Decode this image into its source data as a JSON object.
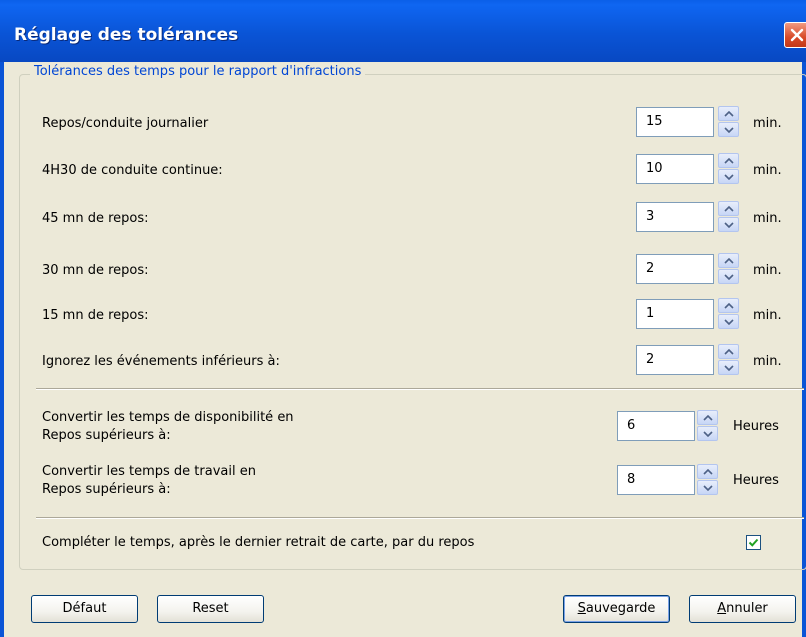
{
  "window": {
    "title": "Réglage des tolérances",
    "close_icon": "close-x-icon"
  },
  "group": {
    "legend": "Tolérances des temps pour le rapport d'infractions"
  },
  "rows": [
    {
      "label": "Repos/conduite journalier",
      "value": "15",
      "unit": "min."
    },
    {
      "label": "4H30 de conduite continue:",
      "value": "10",
      "unit": "min."
    },
    {
      "label": "45 mn de repos:",
      "value": "3",
      "unit": "min."
    },
    {
      "label": "30 mn de repos:",
      "value": "2",
      "unit": "min."
    },
    {
      "label": "15 mn de repos:",
      "value": "1",
      "unit": "min."
    },
    {
      "label": "Ignorez les événements inférieurs à:",
      "value": "2",
      "unit": "min."
    }
  ],
  "convert_rows": [
    {
      "line1": "Convertir les temps de disponibilité en",
      "line2": "Repos supérieurs à:",
      "value": "6",
      "unit": "Heures"
    },
    {
      "line1": "Convertir les temps de travail en",
      "line2": "Repos supérieurs à:",
      "value": "8",
      "unit": "Heures"
    }
  ],
  "complete_rest": {
    "label": "Compléter le temps, après le dernier retrait de carte, par du repos",
    "checked": true
  },
  "buttons": {
    "default_label": "Défaut",
    "reset_label": "Reset",
    "save_label_first": "S",
    "save_label_rest": "auvegarde",
    "cancel_label_first": "A",
    "cancel_label_rest": "nnuler"
  }
}
